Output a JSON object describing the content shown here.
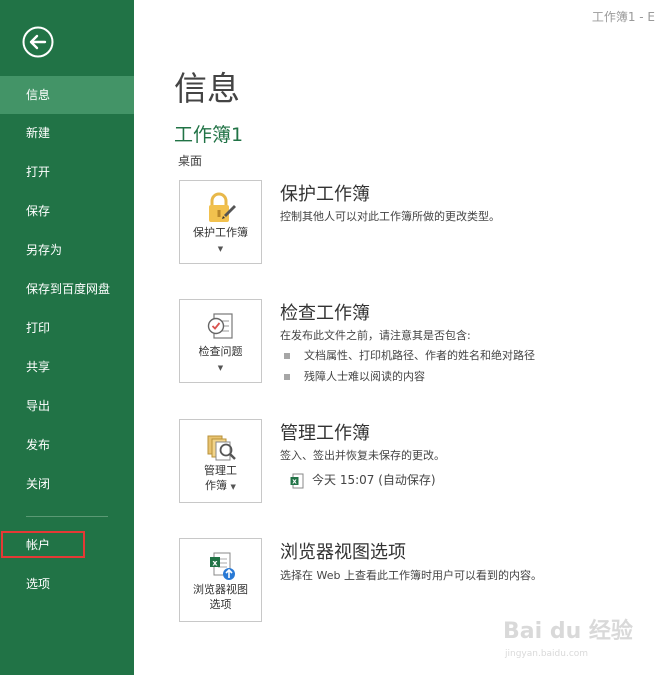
{
  "window": {
    "title": "工作簿1 - E"
  },
  "sidebar": {
    "items": [
      {
        "label": "信息",
        "active": true
      },
      {
        "label": "新建"
      },
      {
        "label": "打开"
      },
      {
        "label": "保存"
      },
      {
        "label": "另存为"
      },
      {
        "label": "保存到百度网盘"
      },
      {
        "label": "打印"
      },
      {
        "label": "共享"
      },
      {
        "label": "导出"
      },
      {
        "label": "发布"
      },
      {
        "label": "关闭"
      },
      {
        "label": "帐户"
      },
      {
        "label": "选项"
      }
    ]
  },
  "main": {
    "title": "信息",
    "doc_name": "工作簿1",
    "doc_location": "桌面",
    "sections": [
      {
        "button_label": "保护工作簿",
        "title": "保护工作簿",
        "description": "控制其他人可以对此工作簿所做的更改类型。",
        "icon": "lock-icon"
      },
      {
        "button_label": "检查问题",
        "title": "检查工作簿",
        "description": "在发布此文件之前，请注意其是否包含:",
        "bullets": [
          "文档属性、打印机路径、作者的姓名和绝对路径",
          "残障人士难以阅读的内容"
        ],
        "icon": "inspect-icon"
      },
      {
        "button_label_line1": "管理工",
        "button_label_line2": "作簿",
        "title": "管理工作簿",
        "description": "签入、签出并恢复未保存的更改。",
        "version": "今天 15:07 (自动保存)",
        "icon": "manage-workbook-icon"
      },
      {
        "button_label_line1": "浏览器视图",
        "button_label_line2": "选项",
        "title": "浏览器视图选项",
        "description": "选择在 Web 上查看此工作簿时用户可以看到的内容。",
        "icon": "browser-view-icon"
      }
    ]
  },
  "watermark": {
    "text": "Bai du 经验",
    "subtext": "jingyan.baidu.com"
  },
  "colors": {
    "sidebar": "#217346",
    "active": "#439467",
    "accent": "#217346",
    "highlight": "#e53935"
  }
}
